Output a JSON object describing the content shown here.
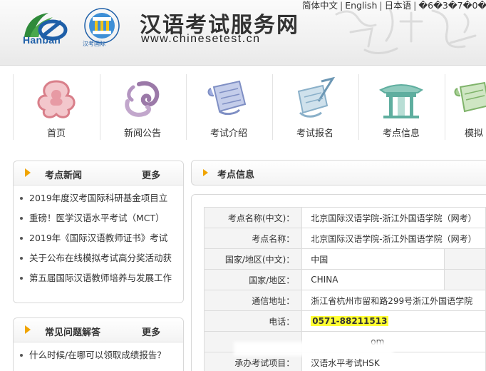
{
  "header": {
    "logo_text": "Hanban",
    "kaoshi_caption": "汉考国际",
    "site_title": "汉语考试服务网",
    "site_url": "www.chinesetest.cn",
    "languages": [
      "简体中文",
      "English",
      "日本语",
      "�6�3�7�0�"
    ]
  },
  "nav": {
    "items": [
      {
        "label": "首页",
        "icon": "ruyi-cloud-icon",
        "color": "#d97f8a"
      },
      {
        "label": "新闻公告",
        "icon": "swirl-cloud-icon",
        "color": "#9b79a8"
      },
      {
        "label": "考试介绍",
        "icon": "scroll-icon",
        "color": "#7f8fc4"
      },
      {
        "label": "考试报名",
        "icon": "brush-scroll-icon",
        "color": "#8ab0c9"
      },
      {
        "label": "考点信息",
        "icon": "pavilion-icon",
        "color": "#5fae9f"
      },
      {
        "label": "模拟",
        "icon": "scroll-green-icon",
        "color": "#7fb36a"
      }
    ]
  },
  "news_box": {
    "title": "考点新闻",
    "more": "更多",
    "items": [
      "2019年度汉考国际科研基金项目立",
      "重磅！医学汉语水平考试（MCT）",
      "2019年《国际汉语教师证书》考试",
      "关于公布在线模拟考试高分奖活动获",
      "第五届国际汉语教师培养与发展工作"
    ]
  },
  "faq_box": {
    "title": "常见问题解答",
    "more": "更多",
    "items": [
      "什么时候/在哪可以领取成绩报告？"
    ]
  },
  "center_info": {
    "title": "考点信息",
    "rows": [
      {
        "label": "考点名称(中文)：",
        "value": "北京国际汉语学院-浙江外国语学院（网考）"
      },
      {
        "label": "考点名称：",
        "value": "北京国际汉语学院-浙江外国语学院（网考）"
      },
      {
        "label": "国家/地区(中文)：",
        "value": "中国"
      },
      {
        "label": "国家/地区：",
        "value": "CHINA"
      },
      {
        "label": "通信地址：",
        "value": "浙江省杭州市留和路299号浙江外国语学院"
      },
      {
        "label": "电话：",
        "value": "0571-88211513"
      },
      {
        "label": "",
        "value": "om"
      },
      {
        "label": "承办考试项目：",
        "value": "汉语水平考试HSK"
      }
    ]
  }
}
